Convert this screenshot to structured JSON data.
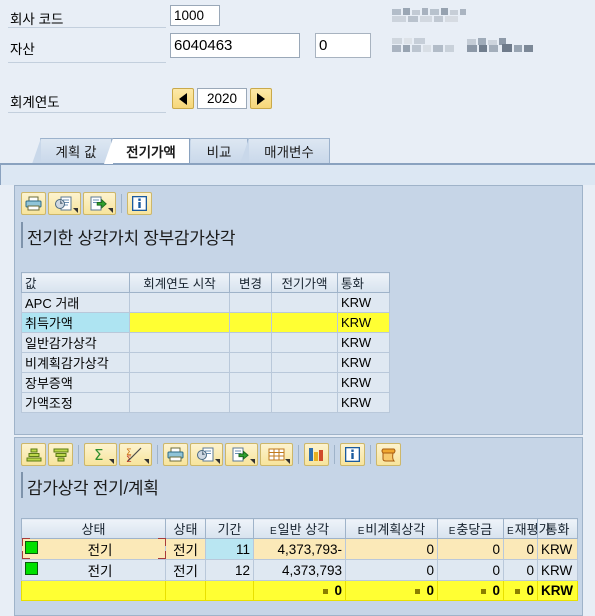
{
  "header": {
    "company_code_label": "회사 코드",
    "company_code_value": "1000",
    "asset_label": "자산",
    "asset_value": "6040463",
    "subnumber_value": "0",
    "fiscal_year_label": "회계연도",
    "fiscal_year_value": "2020",
    "prev_year_icon": "left-triangle-icon",
    "next_year_icon": "right-triangle-icon",
    "redacted_line1": "",
    "redacted_line2": "",
    "redacted_line3": ""
  },
  "tabs": [
    {
      "label": "계획 값",
      "active": false
    },
    {
      "label": "전기가액",
      "active": true
    },
    {
      "label": "비교",
      "active": false
    },
    {
      "label": "매개변수",
      "active": false
    }
  ],
  "panel1": {
    "title": "전기한 상각가치 장부감가상각",
    "toolbar": [
      {
        "name": "print-icon",
        "label": "인쇄"
      },
      {
        "name": "print-preview-icon",
        "label": "인쇄 미리보기"
      },
      {
        "name": "export-icon",
        "label": "내보내기"
      },
      {
        "name": "info-icon",
        "label": "정보"
      }
    ],
    "columns": [
      "값",
      "회계연도 시작",
      "변경",
      "전기가액",
      "통화"
    ],
    "rows": [
      {
        "label": "APC 거래",
        "start": "",
        "change": "",
        "posted": "",
        "currency": "KRW",
        "highlight": false
      },
      {
        "label": "취득가액",
        "start": "",
        "change": "",
        "posted": "",
        "currency": "KRW",
        "highlight": true
      },
      {
        "label": "일반감가상각",
        "start": "",
        "change": "",
        "posted": "",
        "currency": "KRW",
        "highlight": false
      },
      {
        "label": "비계획감가상각",
        "start": "",
        "change": "",
        "posted": "",
        "currency": "KRW",
        "highlight": false
      },
      {
        "label": "장부증액",
        "start": "",
        "change": "",
        "posted": "",
        "currency": "KRW",
        "highlight": false
      },
      {
        "label": "가액조정",
        "start": "",
        "change": "",
        "posted": "",
        "currency": "KRW",
        "highlight": false
      }
    ]
  },
  "panel2": {
    "title": "감가상각 전기/계획",
    "toolbar": [
      {
        "name": "sort-ascending-icon",
        "label": "오름차순 정렬"
      },
      {
        "name": "sort-descending-icon",
        "label": "내림차순 정렬"
      },
      {
        "name": "sum-icon",
        "label": "합계"
      },
      {
        "name": "subtotal-icon",
        "label": "중간합계"
      },
      {
        "name": "print-icon",
        "label": "인쇄"
      },
      {
        "name": "print-preview-icon",
        "label": "인쇄 미리보기"
      },
      {
        "name": "export-icon",
        "label": "내보내기"
      },
      {
        "name": "layout-icon",
        "label": "레이아웃"
      },
      {
        "name": "chart-icon",
        "label": "그래픽"
      },
      {
        "name": "info-icon",
        "label": "정보"
      },
      {
        "name": "script-icon",
        "label": "ABAP 리스트"
      }
    ],
    "columns": [
      {
        "label": "상태",
        "sigma": false
      },
      {
        "label": "상태",
        "sigma": false
      },
      {
        "label": "기간",
        "sigma": false
      },
      {
        "label": "일반 상각",
        "sigma": true
      },
      {
        "label": "비계획상각",
        "sigma": true
      },
      {
        "label": "충당금",
        "sigma": true
      },
      {
        "label": "재평가",
        "sigma": true
      },
      {
        "label": "통화",
        "sigma": false
      }
    ],
    "rows": [
      {
        "status_icon": "green-square-icon",
        "status_text": "전기",
        "status2": "전기",
        "period": "11",
        "ordinary": "4,373,793-",
        "unplanned": "0",
        "reserve": "0",
        "revaluation": "0",
        "currency": "KRW",
        "selected": true
      },
      {
        "status_icon": "green-square-icon",
        "status_text": "전기",
        "status2": "전기",
        "period": "12",
        "ordinary": "4,373,793",
        "unplanned": "0",
        "reserve": "0",
        "revaluation": "0",
        "currency": "KRW",
        "selected": false
      }
    ],
    "total_row": {
      "ordinary": "0",
      "unplanned": "0",
      "reserve": "0",
      "revaluation": "0",
      "currency": "KRW"
    }
  },
  "colors": {
    "background": "#e8eef6",
    "panel": "#c6d5e7",
    "label_cell": "#aee4f2",
    "highlight_yellow": "#ffff33",
    "posted_green": "#c3f0c3",
    "selected_row": "#fbe9b8",
    "status_green": "#00e000",
    "period_cell": "#b9e6f2",
    "toolbar_button": "#f7e49c"
  }
}
